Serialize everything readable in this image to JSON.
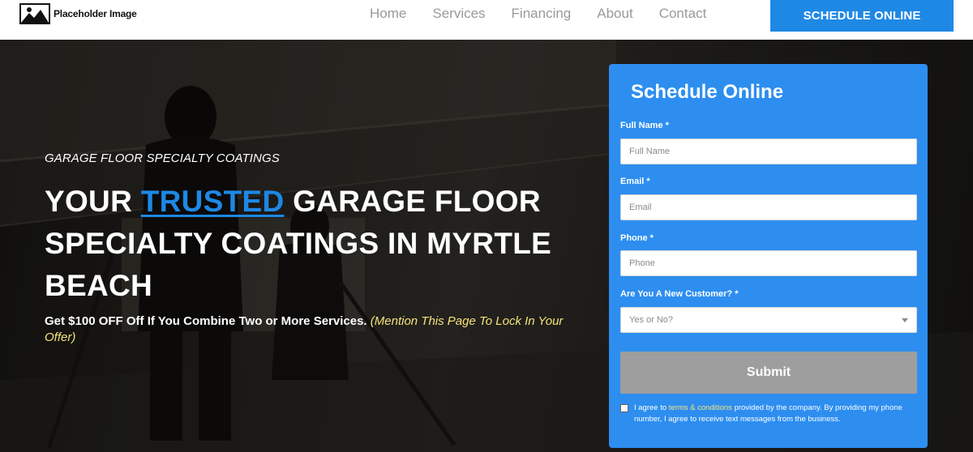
{
  "header": {
    "logo_text": "Placeholder Image",
    "nav": [
      {
        "label": "Home"
      },
      {
        "label": "Services"
      },
      {
        "label": "Financing"
      },
      {
        "label": "About"
      },
      {
        "label": "Contact"
      }
    ],
    "cta_label": "SCHEDULE ONLINE"
  },
  "hero": {
    "eyebrow": "GARAGE FLOOR SPECIALTY COATINGS",
    "headline_pre": "YOUR ",
    "headline_accent": "TRUSTED",
    "headline_post": " GARAGE FLOOR SPECIALTY COATINGS IN MYRTLE BEACH",
    "offer_main": "Get $100 OFF Off If You Combine Two or More Services.",
    "offer_mention": "(Mention This Page To Lock In Your Offer)"
  },
  "form": {
    "title": "Schedule Online",
    "full_name_label": "Full Name *",
    "full_name_placeholder": "Full Name",
    "email_label": "Email *",
    "email_placeholder": "Email",
    "phone_label": "Phone *",
    "phone_placeholder": "Phone",
    "customer_label": "Are You A New Customer? *",
    "customer_selected": "Yes or No?",
    "submit_label": "Submit",
    "consent_pre": "I agree to ",
    "consent_terms": "terms & conditions",
    "consent_post": " provided by the company. By providing my phone number, I agree to receive text messages from the business."
  },
  "colors": {
    "brand_blue": "#1e88e5",
    "form_blue": "#2d8ef0",
    "offer_yellow": "#f6e27a",
    "submit_gray": "#9e9e9e"
  },
  "icons": {
    "logo": "image-placeholder-icon",
    "select": "chevron-down-icon"
  }
}
